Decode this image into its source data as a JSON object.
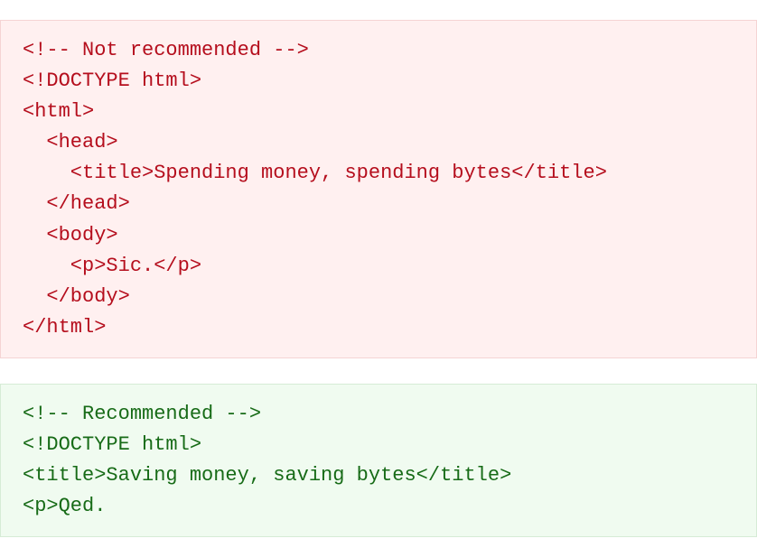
{
  "bad": {
    "lines": [
      "<!-- Not recommended -->",
      "<!DOCTYPE html>",
      "<html>",
      "  <head>",
      "    <title>Spending money, spending bytes</title>",
      "  </head>",
      "  <body>",
      "    <p>Sic.</p>",
      "  </body>",
      "</html>"
    ]
  },
  "good": {
    "lines": [
      "<!-- Recommended -->",
      "<!DOCTYPE html>",
      "<title>Saving money, saving bytes</title>",
      "<p>Qed."
    ]
  }
}
